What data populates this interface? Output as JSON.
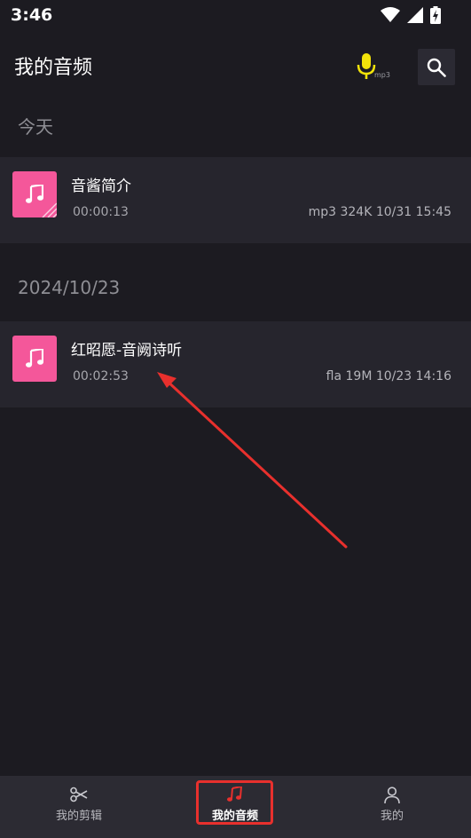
{
  "status_bar": {
    "time": "3:46"
  },
  "header": {
    "title": "我的音频",
    "mic_label": "mp3"
  },
  "colors": {
    "background": "#1c1b21",
    "row": "#26252d",
    "thumb": "#f4579a",
    "mic": "#f2e30a",
    "annotation": "#e8302d"
  },
  "sections": [
    {
      "label": "今天",
      "items": [
        {
          "title": "音酱简介",
          "duration": "00:00:13",
          "meta": "mp3  324K  10/31 15:45"
        }
      ]
    },
    {
      "label": "2024/10/23",
      "items": [
        {
          "title": "红昭愿-音阙诗听",
          "duration": "00:02:53",
          "meta": "fla  19M  10/23 14:16"
        }
      ]
    }
  ],
  "bottom_nav": {
    "items": [
      {
        "label": "我的剪辑",
        "icon": "scissors-icon"
      },
      {
        "label": "我的音频",
        "icon": "music-note-icon",
        "active": true
      },
      {
        "label": "我的",
        "icon": "person-icon"
      }
    ]
  }
}
